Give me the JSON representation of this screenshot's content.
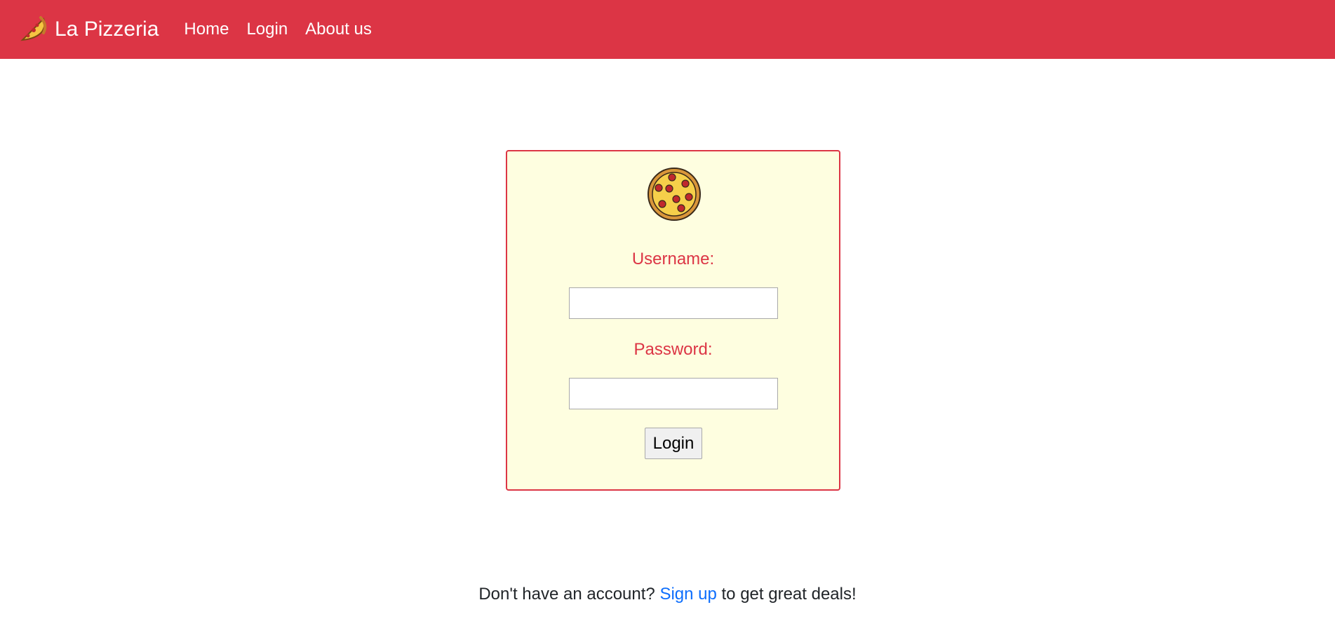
{
  "navbar": {
    "brand": "La Pizzeria",
    "links": [
      {
        "label": "Home"
      },
      {
        "label": "Login"
      },
      {
        "label": "About us"
      }
    ],
    "background_color": "#dc3545"
  },
  "login_form": {
    "logo_icon": "pizza-icon",
    "username_label": "Username:",
    "username_value": "",
    "password_label": "Password:",
    "password_value": "",
    "submit_label": "Login",
    "border_color": "#dc3545",
    "background_color": "#fefee0"
  },
  "signup_prompt": {
    "before": "Don't have an account? ",
    "link_text": "Sign up",
    "after": " to get great deals!",
    "link_color": "#0d6efd"
  }
}
